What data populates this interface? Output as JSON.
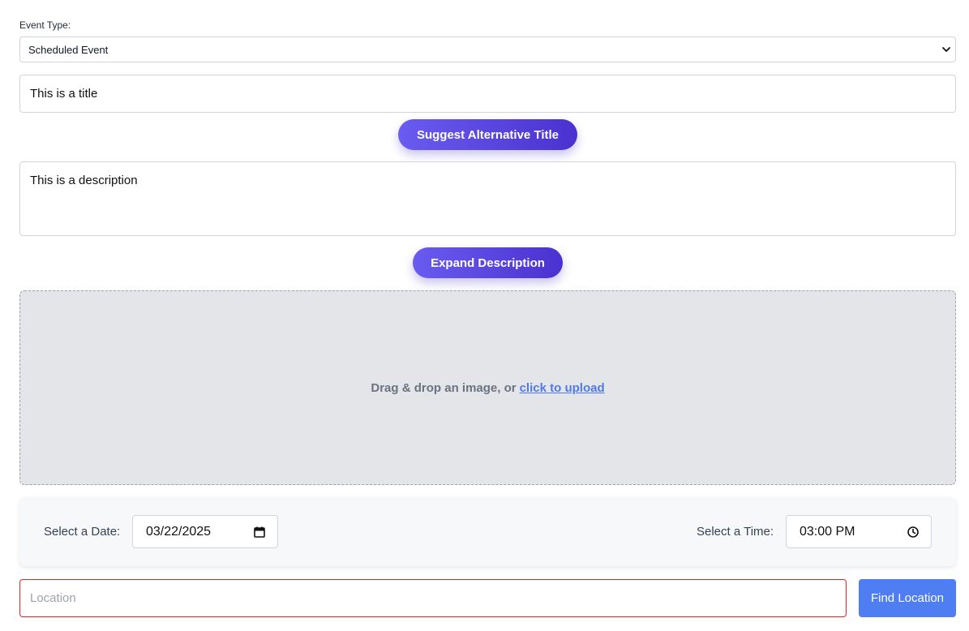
{
  "event_type": {
    "label": "Event Type:",
    "selected": "Scheduled Event"
  },
  "title_field": {
    "value": "This is a title"
  },
  "suggest_button": {
    "label": "Suggest Alternative Title"
  },
  "description_field": {
    "value": "This is a description"
  },
  "expand_button": {
    "label": "Expand Description"
  },
  "upload": {
    "prompt": "Drag & drop an image, or",
    "link_label": "click to upload"
  },
  "date": {
    "label": "Select a Date:",
    "value": "03/22/2025",
    "icon": "calendar-icon"
  },
  "time": {
    "label": "Select a Time:",
    "value": "03:00 PM",
    "icon": "clock-icon"
  },
  "location": {
    "placeholder": "Location",
    "button_label": "Find Location"
  },
  "colors": {
    "accent_gradient_start": "#6a5cf0",
    "accent_gradient_end": "#4a31d0",
    "find_button": "#4f7ef2",
    "location_border_error": "#dc2626",
    "link": "#4f7ae8"
  }
}
